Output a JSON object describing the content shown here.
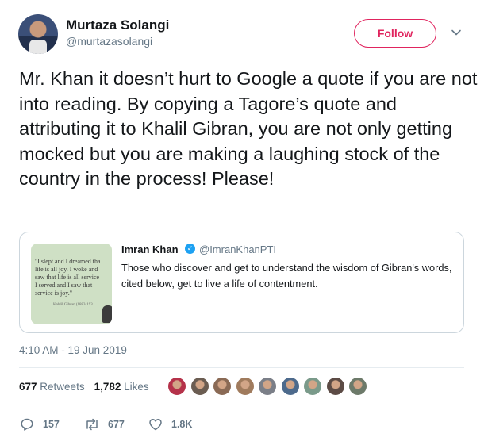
{
  "author": {
    "name": "Murtaza Solangi",
    "handle": "@murtazasolangi"
  },
  "follow_label": "Follow",
  "tweet_text": "Mr. Khan it doesn’t hurt to Google a quote if you are not into reading. By copying a Tagore’s quote and attributing it to Khalil Gibran, you are not only getting mocked but you are making a laughing stock of the country in the process! Please!",
  "quoted_tweet": {
    "name": "Imran Khan",
    "handle": "@ImranKhanPTI",
    "text": "Those who discover and get to understand the wisdom of Gibran's words, cited below, get to live a life of contentment.",
    "image_text": "\"I slept and I dreamed tha\nlife is all joy. I woke and\nsaw that life is all service\nI served and I saw that\nservice is joy.\"",
    "image_caption": "Kahlil Gibran (1883-193"
  },
  "timestamp": "4:10 AM - 19 Jun 2019",
  "stats": {
    "retweets_count": "677",
    "retweets_label": "Retweets",
    "likes_count": "1,782",
    "likes_label": "Likes"
  },
  "liker_colors": [
    "#b5324a",
    "#6b5d52",
    "#8a6a55",
    "#a07b5d",
    "#7b7f88",
    "#4d6a8c",
    "#7a9a8a",
    "#5c4b45",
    "#6d7a6a"
  ],
  "actions": {
    "reply_count": "157",
    "retweet_count": "677",
    "like_count": "1.8K"
  },
  "colors": {
    "follow_accent": "#e0245e",
    "verified": "#1da1f2",
    "muted_text": "#657786"
  }
}
